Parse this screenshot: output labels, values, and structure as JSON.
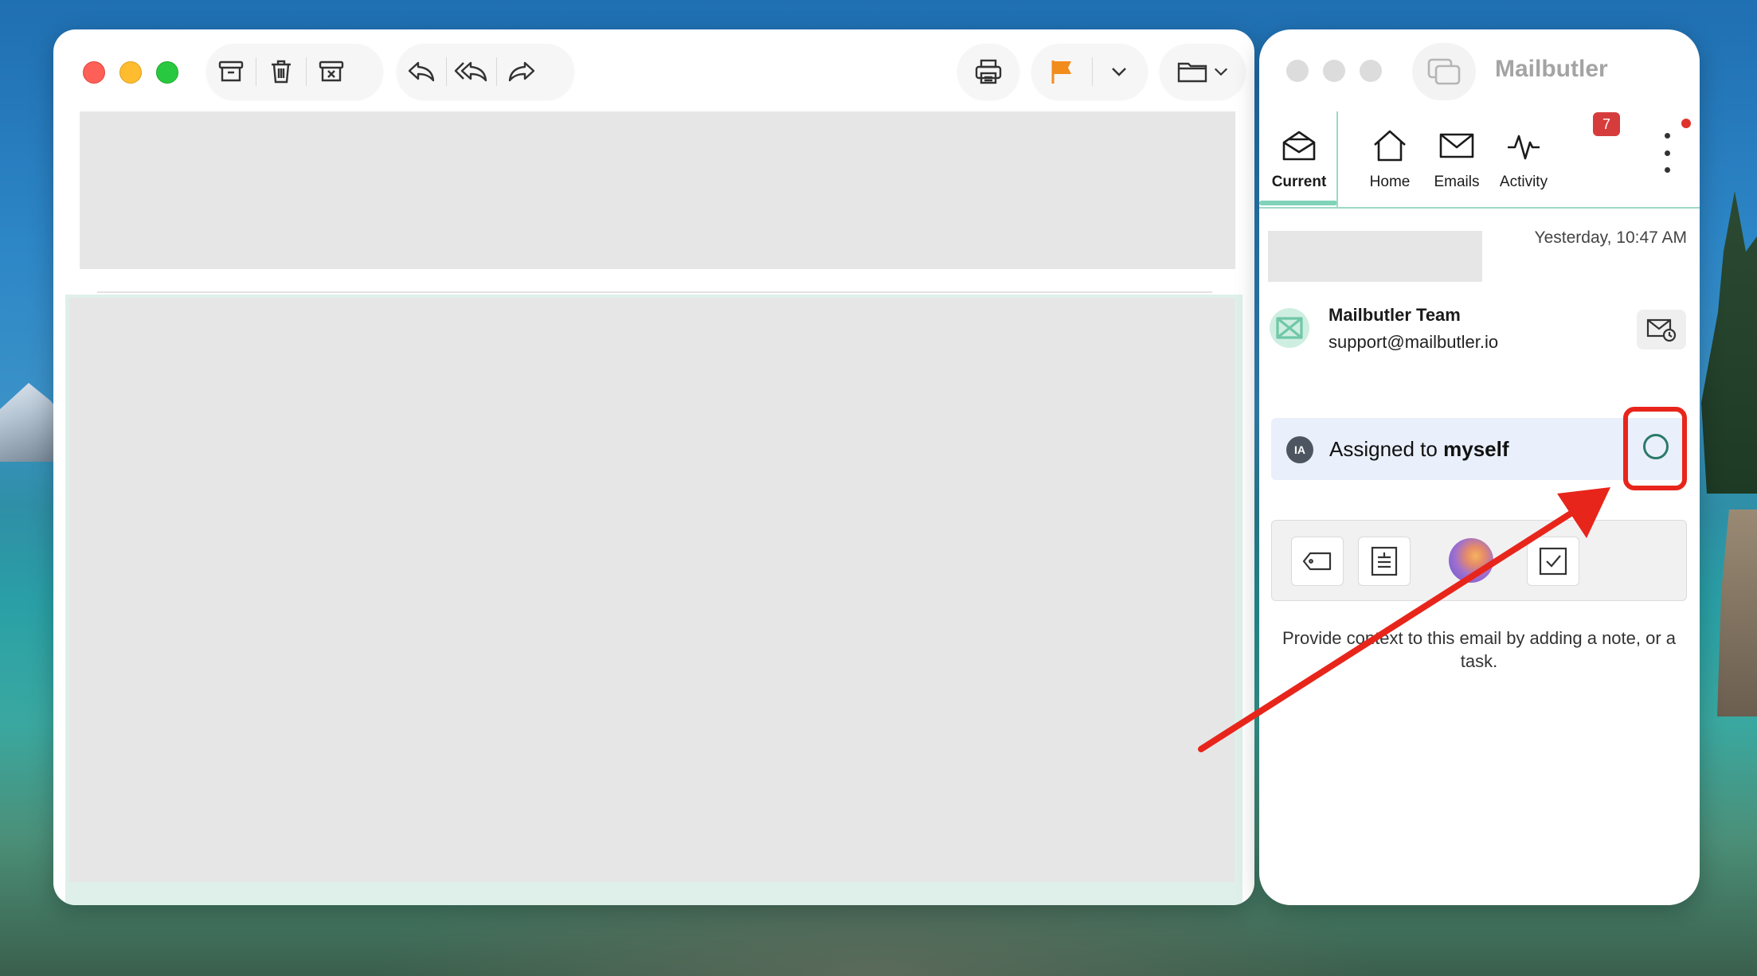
{
  "mail_window": {
    "toolbar": {
      "archive_icon": "archive-icon",
      "delete_icon": "trash-icon",
      "junk_icon": "junk-icon",
      "reply_icon": "reply-icon",
      "reply_all_icon": "reply-all-icon",
      "forward_icon": "forward-icon",
      "print_icon": "print-icon",
      "flag_icon": "flag-icon",
      "flag_color": "#f28c1d",
      "move_icon": "folder-icon"
    }
  },
  "mailbutler": {
    "title": "Mailbutler",
    "tabs": [
      {
        "label": "Current",
        "icon": "envelope-open-icon",
        "active": true
      },
      {
        "label": "Home",
        "icon": "home-icon",
        "active": false
      },
      {
        "label": "Emails",
        "icon": "envelope-icon",
        "active": false
      },
      {
        "label": "Activity",
        "icon": "activity-icon",
        "active": false
      }
    ],
    "activity_badge": "7",
    "email": {
      "date": "Yesterday, 10:47 AM",
      "sender_name": "Mailbutler Team",
      "sender_email": "support@mailbutler.io"
    },
    "assignment": {
      "avatar_initials": "IA",
      "prefix": "Assigned to",
      "assignee": "myself"
    },
    "hint": "Provide context to this email by adding a note, or a task.",
    "accent_color": "#7fd3b8",
    "highlight_color": "#e8251b"
  }
}
